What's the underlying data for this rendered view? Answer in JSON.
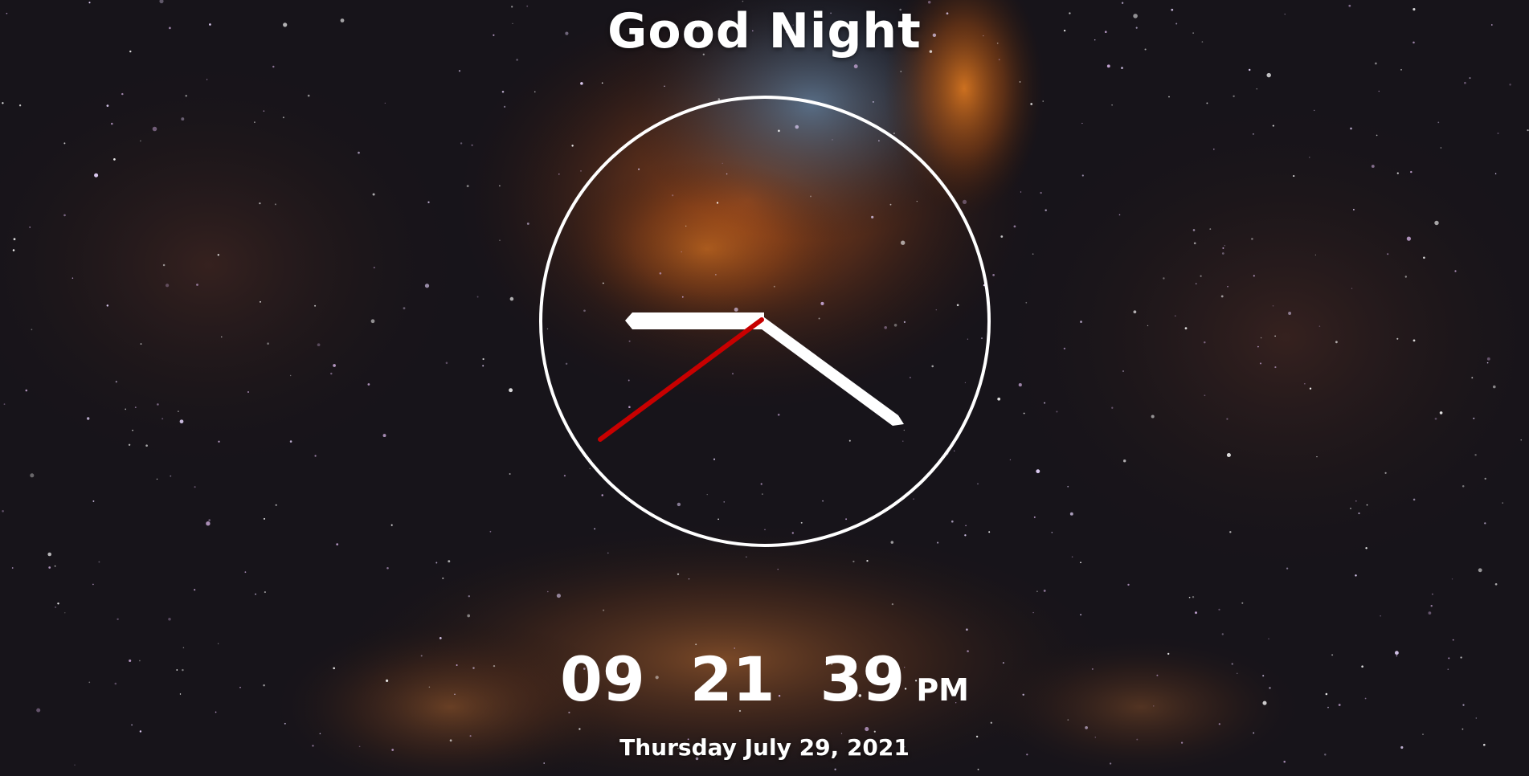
{
  "greeting": "Good Night",
  "time": {
    "hours": "09",
    "minutes": "21",
    "seconds": "39",
    "period": "PM"
  },
  "date": "Thursday July 29, 2021",
  "colors": {
    "hands": "#ffffff",
    "second_hand": "#c80000",
    "face_ring": "#ffffff",
    "text": "#ffffff"
  }
}
